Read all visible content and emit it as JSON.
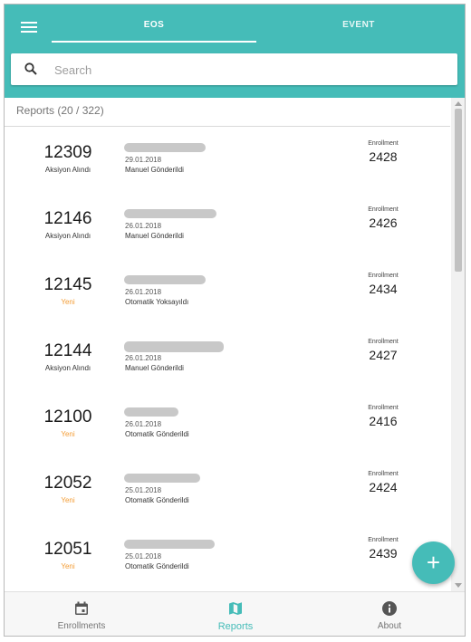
{
  "tabs": {
    "eos": "EOS",
    "event": "EVENT"
  },
  "search": {
    "placeholder": "Search"
  },
  "list": {
    "header": "Reports (20 / 322)"
  },
  "reports": [
    {
      "number": "12309",
      "status": "Aksiyon Alındı",
      "date": "29.01.2018",
      "method": "Manuel Gönderildi",
      "enrollment_label": "Enrollment",
      "enrollment": "2428"
    },
    {
      "number": "12146",
      "status": "Aksiyon Alındı",
      "date": "26.01.2018",
      "method": "Manuel Gönderildi",
      "enrollment_label": "Enrollment",
      "enrollment": "2426"
    },
    {
      "number": "12145",
      "status": "Yeni",
      "date": "26.01.2018",
      "method": "Otomatik Yoksayıldı",
      "enrollment_label": "Enrollment",
      "enrollment": "2434"
    },
    {
      "number": "12144",
      "status": "Aksiyon Alındı",
      "date": "26.01.2018",
      "method": "Manuel Gönderildi",
      "enrollment_label": "Enrollment",
      "enrollment": "2427"
    },
    {
      "number": "12100",
      "status": "Yeni",
      "date": "26.01.2018",
      "method": "Otomatik Gönderildi",
      "enrollment_label": "Enrollment",
      "enrollment": "2416"
    },
    {
      "number": "12052",
      "status": "Yeni",
      "date": "25.01.2018",
      "method": "Otomatik Gönderildi",
      "enrollment_label": "Enrollment",
      "enrollment": "2424"
    },
    {
      "number": "12051",
      "status": "Yeni",
      "date": "25.01.2018",
      "method": "Otomatik Gönderildi",
      "enrollment_label": "Enrollment",
      "enrollment": "2439"
    }
  ],
  "fab": {
    "icon": "plus-icon",
    "symbol": "+"
  },
  "nav": {
    "enrollments": {
      "label": "Enrollments",
      "icon": "calendar-icon"
    },
    "reports": {
      "label": "Reports",
      "icon": "map-icon"
    },
    "about": {
      "label": "About",
      "icon": "info-icon"
    }
  },
  "colors": {
    "accent": "#45bcb8",
    "status_new": "#f39c34"
  }
}
